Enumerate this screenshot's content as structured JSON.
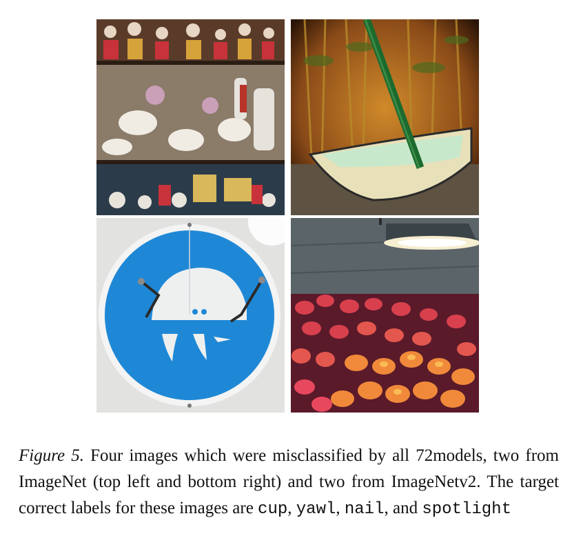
{
  "figure": {
    "panels": [
      {
        "label": "cup",
        "source": "ImageNet"
      },
      {
        "label": "yawl",
        "source": "ImageNetv2"
      },
      {
        "label": "nail",
        "source": "ImageNetv2"
      },
      {
        "label": "spotlight",
        "source": "ImageNet"
      }
    ],
    "caption": {
      "figure_label": "Figure 5.",
      "text_part1": " Four images which were misclassified by all 72models, two from ImageNet (top left and bottom right) and two from ImageNetv2. The target correct labels for these images are ",
      "label_1": "cup",
      "sep_1": ", ",
      "label_2": "yawl",
      "sep_2": ", ",
      "label_3": "nail",
      "sep_3": ", and ",
      "label_4": "spotlight"
    }
  }
}
